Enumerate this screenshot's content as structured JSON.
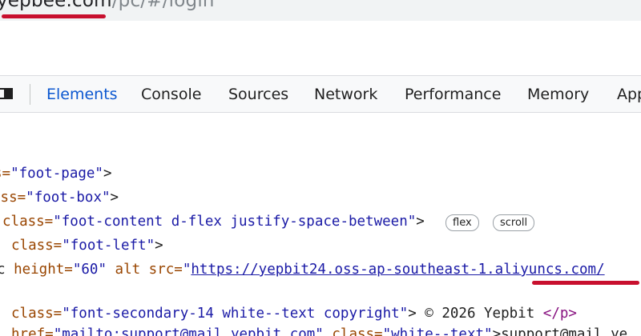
{
  "address_bar": {
    "domain": "yepbee.com",
    "path": "/pc/#/login"
  },
  "devtools": {
    "tabs": [
      "Elements",
      "Console",
      "Sources",
      "Network",
      "Performance",
      "Memory",
      "App"
    ],
    "active_tab": "Elements",
    "dock_icon": "dock-side-icon"
  },
  "code": {
    "line1": {
      "prefix": "s=",
      "value": "\"foot-page\"",
      "suffix": ">"
    },
    "line2": {
      "prefix": "ass=",
      "value": "\"foot-box\"",
      "suffix": ">"
    },
    "line3": {
      "attr": "class=",
      "value": "\"foot-content d-flex justify-space-between\"",
      "suffix": ">"
    },
    "line3_badges": [
      "flex",
      "scroll"
    ],
    "line4": {
      "attr": "class=",
      "value": "\"foot-left\"",
      "suffix": ">"
    },
    "line5": {
      "prefix": "c ",
      "attr1": "height=",
      "value1": "\"60\"",
      "attr2": " alt src=",
      "quote": "\"",
      "link": "https://yepbit24.oss-ap-southeast-1.aliyuncs.com/"
    },
    "line6": {
      "attr": "class=",
      "value": "\"font-secondary-14 white--text copyright\"",
      "suffix": "> © 2026 Yepbit ",
      "close": "</p>"
    },
    "line7": {
      "prefix": "href=",
      "value": "\"mailto:support@mail.yepbit.com\"",
      "attr": " class=",
      "value2": "\"white--text\"",
      "suffix": ">support@mail.ye"
    }
  },
  "colors": {
    "annotation_underline": "#c8102e",
    "active_tab": "#0b57d0",
    "attribute_value": "#1a1aa6"
  }
}
